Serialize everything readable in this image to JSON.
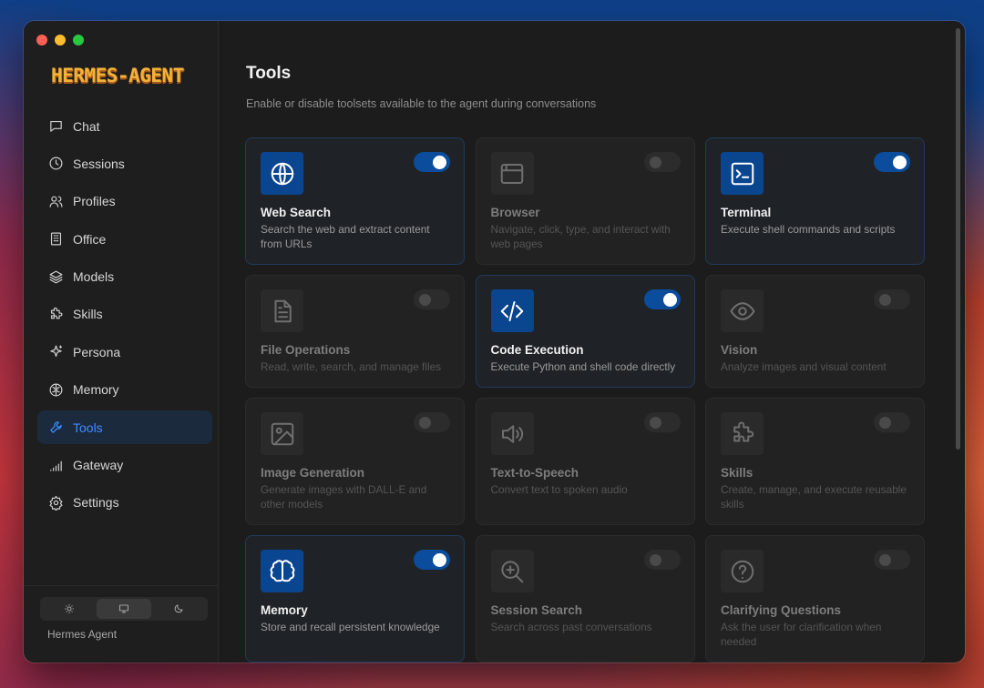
{
  "app": {
    "logo_text": "HERMES-AGENT",
    "footer_name": "Hermes Agent"
  },
  "sidebar": {
    "items": [
      {
        "label": "Chat",
        "icon": "chat-icon"
      },
      {
        "label": "Sessions",
        "icon": "clock-icon"
      },
      {
        "label": "Profiles",
        "icon": "users-icon"
      },
      {
        "label": "Office",
        "icon": "building-icon"
      },
      {
        "label": "Models",
        "icon": "layers-icon"
      },
      {
        "label": "Skills",
        "icon": "puzzle-icon"
      },
      {
        "label": "Persona",
        "icon": "sparkle-icon"
      },
      {
        "label": "Memory",
        "icon": "brain-icon"
      },
      {
        "label": "Tools",
        "icon": "wrench-icon",
        "active": true
      },
      {
        "label": "Gateway",
        "icon": "signal-icon"
      },
      {
        "label": "Settings",
        "icon": "gear-icon"
      }
    ],
    "theme_options": [
      "light",
      "system",
      "dark"
    ],
    "theme_selected": "system"
  },
  "main": {
    "title": "Tools",
    "subtitle": "Enable or disable toolsets available to the agent during conversations",
    "tools": [
      {
        "name": "Web Search",
        "desc": "Search the web and extract content from URLs",
        "enabled": true,
        "icon": "globe-icon"
      },
      {
        "name": "Browser",
        "desc": "Navigate, click, type, and interact with web pages",
        "enabled": false,
        "icon": "browser-window-icon"
      },
      {
        "name": "Terminal",
        "desc": "Execute shell commands and scripts",
        "enabled": true,
        "icon": "terminal-icon"
      },
      {
        "name": "File Operations",
        "desc": "Read, write, search, and manage files",
        "enabled": false,
        "icon": "file-icon"
      },
      {
        "name": "Code Execution",
        "desc": "Execute Python and shell code directly",
        "enabled": true,
        "icon": "code-icon"
      },
      {
        "name": "Vision",
        "desc": "Analyze images and visual content",
        "enabled": false,
        "icon": "eye-icon"
      },
      {
        "name": "Image Generation",
        "desc": "Generate images with DALL-E and other models",
        "enabled": false,
        "icon": "image-icon"
      },
      {
        "name": "Text-to-Speech",
        "desc": "Convert text to spoken audio",
        "enabled": false,
        "icon": "speaker-icon"
      },
      {
        "name": "Skills",
        "desc": "Create, manage, and execute reusable skills",
        "enabled": false,
        "icon": "puzzle-icon"
      },
      {
        "name": "Memory",
        "desc": "Store and recall persistent knowledge",
        "enabled": true,
        "icon": "brain-icon"
      },
      {
        "name": "Session Search",
        "desc": "Search across past conversations",
        "enabled": false,
        "icon": "zoom-in-icon"
      },
      {
        "name": "Clarifying Questions",
        "desc": "Ask the user for clarification when needed",
        "enabled": false,
        "icon": "question-icon"
      }
    ]
  },
  "colors": {
    "accent": "#3b8fff",
    "toggle_on": "#0b4d9c",
    "icon_bg_on": "#0a4590",
    "logo": "#f2b23a"
  }
}
